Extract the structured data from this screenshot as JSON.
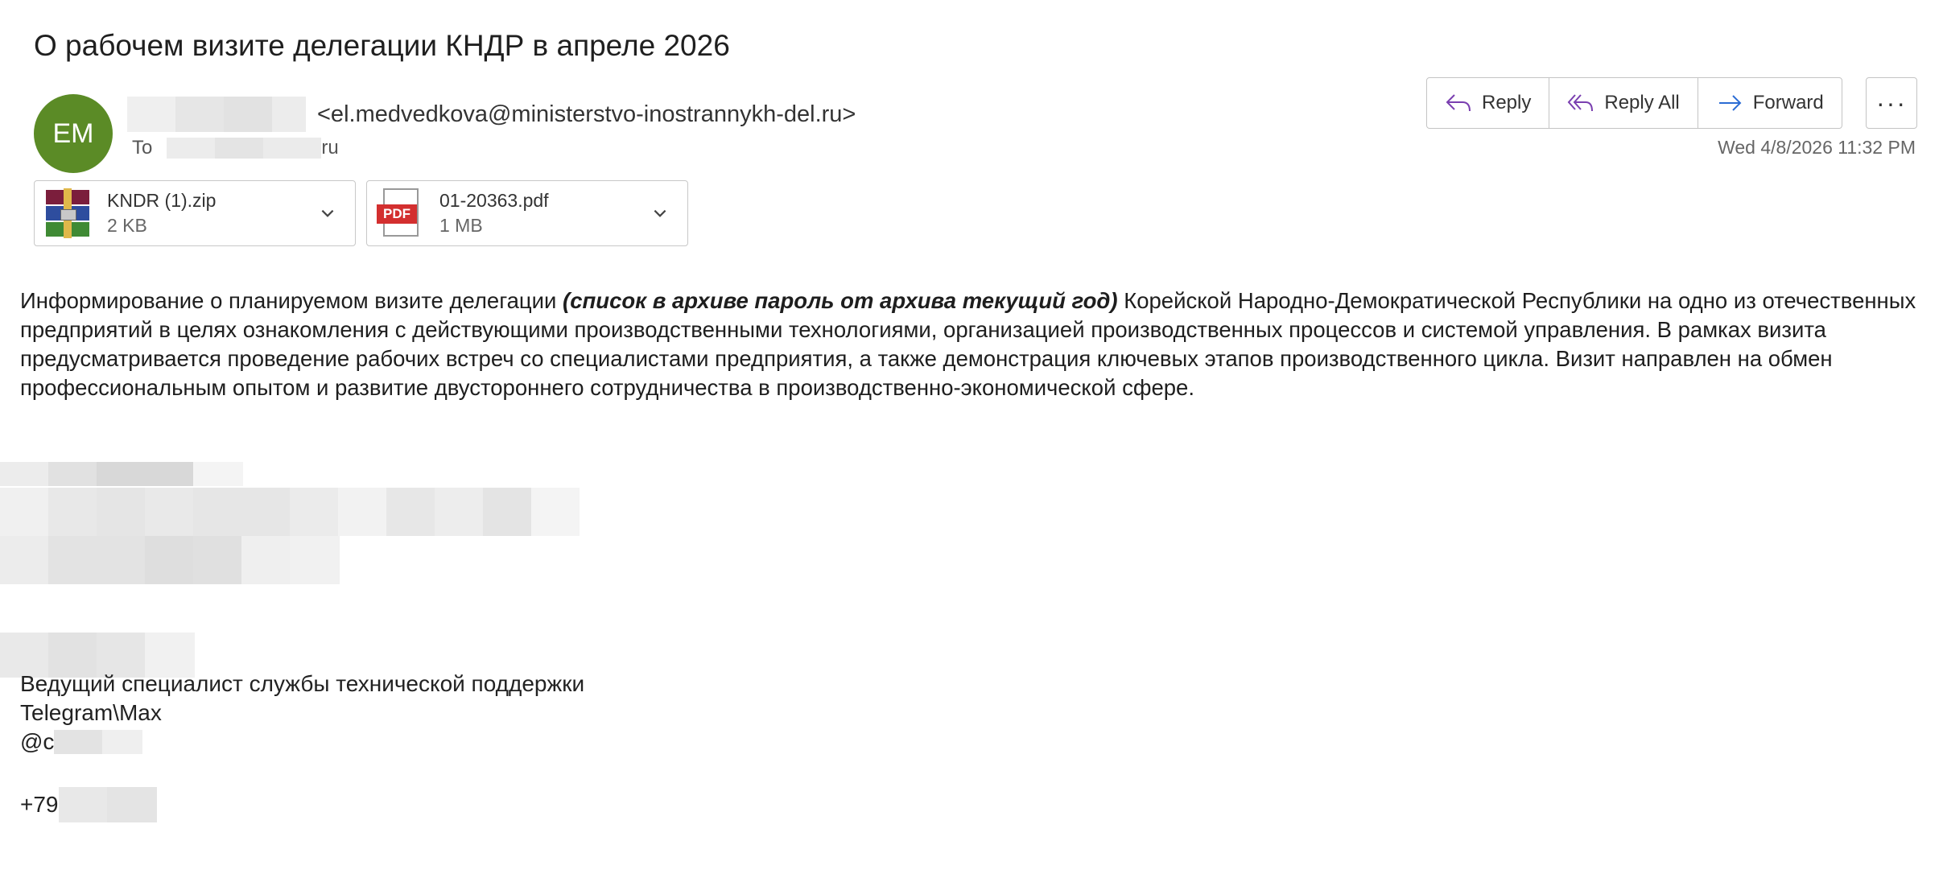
{
  "email": {
    "subject": "О рабочем визите делегации КНДР в апреле 2026",
    "avatar_initials": "EM",
    "avatar_color": "#5b8b26",
    "sender_email": "<el.medvedkova@ministerstvo-inostrannykh-del.ru>",
    "to_label": "To",
    "to_suffix": "ru",
    "date": "Wed 4/8/2026 11:32 PM"
  },
  "actions": {
    "reply": "Reply",
    "reply_all": "Reply All",
    "forward": "Forward",
    "more": "···"
  },
  "attachments": [
    {
      "name": "KNDR (1).zip",
      "size": "2 KB",
      "icon": "winrar-archive-icon"
    },
    {
      "name": "01-20363.pdf",
      "size": "1 MB",
      "icon": "pdf-icon",
      "badge": "PDF"
    }
  ],
  "body": {
    "intro": "Информирование о планируемом визите делегации ",
    "emphasis": "(список в архиве пароль от архива текущий год)",
    "rest": " Корейской Народно-Демократической Республики на одно из отечественных предприятий в целях ознакомления с действующими производственными технологиями, организацией производственных процессов и системой управления. В рамках визита предусматривается проведение рабочих встреч со специалистами предприятия, а также демонстрация ключевых этапов производственного цикла. Визит направлен на обмен профессиональным опытом и развитие двустороннего сотрудничества в производственно-экономической сфере."
  },
  "signature": {
    "title": "Ведущий специалист службы технической поддержки",
    "messengers": "Telegram\\Max",
    "handle_prefix": "@c",
    "phone_prefix": "+79"
  },
  "colors": {
    "accent_purple": "#7a3fb0",
    "accent_blue": "#2b6cd4",
    "pdf_red": "#d32f2f"
  }
}
